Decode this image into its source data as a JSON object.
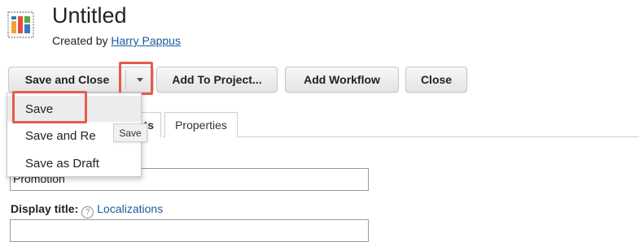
{
  "header": {
    "icon": "dashboard-report-icon",
    "title": "Untitled",
    "created_by_prefix": "Created by",
    "author": "Harry Pappus"
  },
  "toolbar": {
    "save_and_close_label": "Save and Close",
    "dropdown_icon": "chevron-down-icon",
    "add_to_project_label": "Add To Project...",
    "add_workflow_label": "Add Workflow",
    "close_label": "Close"
  },
  "save_menu": {
    "items": [
      {
        "label": "Save"
      },
      {
        "label": "Save and Re"
      },
      {
        "label": "Save as Draft"
      }
    ],
    "tooltip": "Save",
    "tab_peek": "ts"
  },
  "tabs": [
    {
      "label": "Properties"
    }
  ],
  "form": {
    "name_value": "Promotion",
    "display_title_label": "Display title:",
    "help_icon": "question-mark-icon",
    "localizations_link": "Localizations",
    "display_title_value": ""
  },
  "colors": {
    "highlight": "#ea5a4a",
    "link": "#1a5a9e"
  }
}
